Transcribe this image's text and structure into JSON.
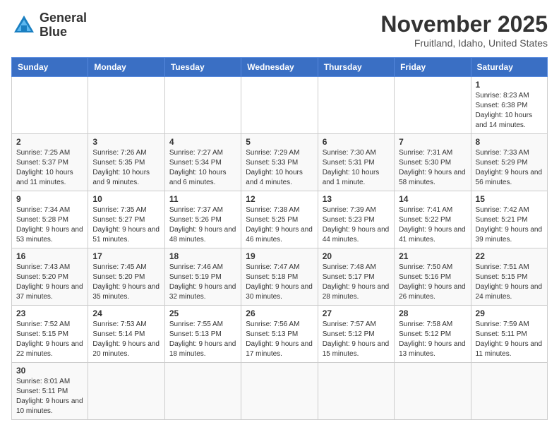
{
  "header": {
    "logo_line1": "General",
    "logo_line2": "Blue",
    "month_year": "November 2025",
    "location": "Fruitland, Idaho, United States"
  },
  "weekdays": [
    "Sunday",
    "Monday",
    "Tuesday",
    "Wednesday",
    "Thursday",
    "Friday",
    "Saturday"
  ],
  "weeks": [
    [
      {
        "day": "",
        "info": ""
      },
      {
        "day": "",
        "info": ""
      },
      {
        "day": "",
        "info": ""
      },
      {
        "day": "",
        "info": ""
      },
      {
        "day": "",
        "info": ""
      },
      {
        "day": "",
        "info": ""
      },
      {
        "day": "1",
        "info": "Sunrise: 8:23 AM\nSunset: 6:38 PM\nDaylight: 10 hours and 14 minutes."
      }
    ],
    [
      {
        "day": "2",
        "info": "Sunrise: 7:25 AM\nSunset: 5:37 PM\nDaylight: 10 hours and 11 minutes."
      },
      {
        "day": "3",
        "info": "Sunrise: 7:26 AM\nSunset: 5:35 PM\nDaylight: 10 hours and 9 minutes."
      },
      {
        "day": "4",
        "info": "Sunrise: 7:27 AM\nSunset: 5:34 PM\nDaylight: 10 hours and 6 minutes."
      },
      {
        "day": "5",
        "info": "Sunrise: 7:29 AM\nSunset: 5:33 PM\nDaylight: 10 hours and 4 minutes."
      },
      {
        "day": "6",
        "info": "Sunrise: 7:30 AM\nSunset: 5:31 PM\nDaylight: 10 hours and 1 minute."
      },
      {
        "day": "7",
        "info": "Sunrise: 7:31 AM\nSunset: 5:30 PM\nDaylight: 9 hours and 58 minutes."
      },
      {
        "day": "8",
        "info": "Sunrise: 7:33 AM\nSunset: 5:29 PM\nDaylight: 9 hours and 56 minutes."
      }
    ],
    [
      {
        "day": "9",
        "info": "Sunrise: 7:34 AM\nSunset: 5:28 PM\nDaylight: 9 hours and 53 minutes."
      },
      {
        "day": "10",
        "info": "Sunrise: 7:35 AM\nSunset: 5:27 PM\nDaylight: 9 hours and 51 minutes."
      },
      {
        "day": "11",
        "info": "Sunrise: 7:37 AM\nSunset: 5:26 PM\nDaylight: 9 hours and 48 minutes."
      },
      {
        "day": "12",
        "info": "Sunrise: 7:38 AM\nSunset: 5:25 PM\nDaylight: 9 hours and 46 minutes."
      },
      {
        "day": "13",
        "info": "Sunrise: 7:39 AM\nSunset: 5:23 PM\nDaylight: 9 hours and 44 minutes."
      },
      {
        "day": "14",
        "info": "Sunrise: 7:41 AM\nSunset: 5:22 PM\nDaylight: 9 hours and 41 minutes."
      },
      {
        "day": "15",
        "info": "Sunrise: 7:42 AM\nSunset: 5:21 PM\nDaylight: 9 hours and 39 minutes."
      }
    ],
    [
      {
        "day": "16",
        "info": "Sunrise: 7:43 AM\nSunset: 5:20 PM\nDaylight: 9 hours and 37 minutes."
      },
      {
        "day": "17",
        "info": "Sunrise: 7:45 AM\nSunset: 5:20 PM\nDaylight: 9 hours and 35 minutes."
      },
      {
        "day": "18",
        "info": "Sunrise: 7:46 AM\nSunset: 5:19 PM\nDaylight: 9 hours and 32 minutes."
      },
      {
        "day": "19",
        "info": "Sunrise: 7:47 AM\nSunset: 5:18 PM\nDaylight: 9 hours and 30 minutes."
      },
      {
        "day": "20",
        "info": "Sunrise: 7:48 AM\nSunset: 5:17 PM\nDaylight: 9 hours and 28 minutes."
      },
      {
        "day": "21",
        "info": "Sunrise: 7:50 AM\nSunset: 5:16 PM\nDaylight: 9 hours and 26 minutes."
      },
      {
        "day": "22",
        "info": "Sunrise: 7:51 AM\nSunset: 5:15 PM\nDaylight: 9 hours and 24 minutes."
      }
    ],
    [
      {
        "day": "23",
        "info": "Sunrise: 7:52 AM\nSunset: 5:15 PM\nDaylight: 9 hours and 22 minutes."
      },
      {
        "day": "24",
        "info": "Sunrise: 7:53 AM\nSunset: 5:14 PM\nDaylight: 9 hours and 20 minutes."
      },
      {
        "day": "25",
        "info": "Sunrise: 7:55 AM\nSunset: 5:13 PM\nDaylight: 9 hours and 18 minutes."
      },
      {
        "day": "26",
        "info": "Sunrise: 7:56 AM\nSunset: 5:13 PM\nDaylight: 9 hours and 17 minutes."
      },
      {
        "day": "27",
        "info": "Sunrise: 7:57 AM\nSunset: 5:12 PM\nDaylight: 9 hours and 15 minutes."
      },
      {
        "day": "28",
        "info": "Sunrise: 7:58 AM\nSunset: 5:12 PM\nDaylight: 9 hours and 13 minutes."
      },
      {
        "day": "29",
        "info": "Sunrise: 7:59 AM\nSunset: 5:11 PM\nDaylight: 9 hours and 11 minutes."
      }
    ],
    [
      {
        "day": "30",
        "info": "Sunrise: 8:01 AM\nSunset: 5:11 PM\nDaylight: 9 hours and 10 minutes."
      },
      {
        "day": "",
        "info": ""
      },
      {
        "day": "",
        "info": ""
      },
      {
        "day": "",
        "info": ""
      },
      {
        "day": "",
        "info": ""
      },
      {
        "day": "",
        "info": ""
      },
      {
        "day": "",
        "info": ""
      }
    ]
  ]
}
